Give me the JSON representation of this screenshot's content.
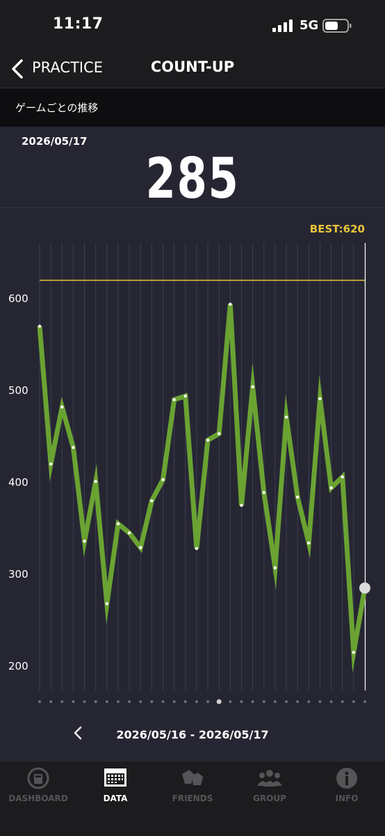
{
  "status": {
    "time": "11:17",
    "network": "5G"
  },
  "nav": {
    "back_label": "PRACTICE",
    "title": "COUNT-UP"
  },
  "sub_header": {
    "title": "ゲームごとの推移"
  },
  "score": {
    "date": "2026/05/17",
    "value": "285"
  },
  "chart_data": {
    "type": "line",
    "best_label": "BEST:620",
    "best_value": 620,
    "yticks": [
      200,
      300,
      400,
      500,
      600
    ],
    "ylim": [
      180,
      650
    ],
    "values": [
      570,
      420,
      482,
      438,
      336,
      401,
      268,
      355,
      345,
      329,
      380,
      403,
      490,
      494,
      328,
      446,
      453,
      594,
      375,
      504,
      389,
      307,
      471,
      384,
      334,
      491,
      394,
      406,
      215,
      285
    ],
    "selected_index": 29,
    "line_color": "#6aa332",
    "best_color": "#e8c53a"
  },
  "pager": {
    "count": 30,
    "active": 16
  },
  "date_nav": {
    "range": "2026/05/16 - 2026/05/17"
  },
  "tabs": [
    {
      "label": "DASHBOARD",
      "icon": "dashboard-icon"
    },
    {
      "label": "DATA",
      "icon": "data-icon"
    },
    {
      "label": "FRIENDS",
      "icon": "friends-icon"
    },
    {
      "label": "GROUP",
      "icon": "group-icon"
    },
    {
      "label": "INFO",
      "icon": "info-icon"
    }
  ],
  "active_tab": "DATA"
}
